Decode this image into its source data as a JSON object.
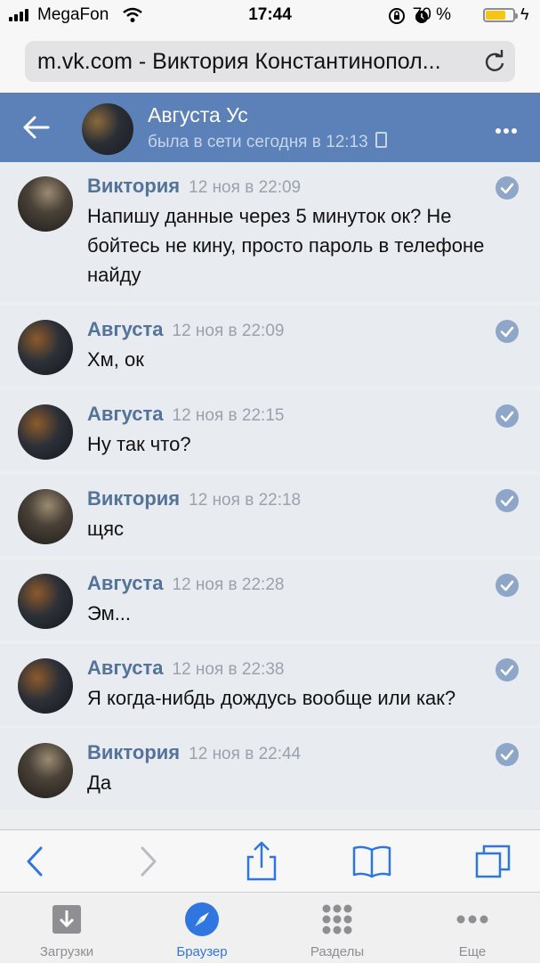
{
  "status_bar": {
    "carrier": "MegaFon",
    "time": "17:44",
    "battery": "70 %",
    "battery_level": 0.7
  },
  "browser": {
    "url": "m.vk.com - Виктория Константинопол..."
  },
  "header": {
    "name": "Августа Ус",
    "status": "была в сети сегодня в 12:13"
  },
  "messages": [
    {
      "author": "Виктория",
      "date": "12 ноя в 22:09",
      "text": "Напишу данные через 5 минуток ок? Не бойтесь не кину, просто пароль в телефоне найду",
      "avatar": "viktoria"
    },
    {
      "author": "Августа",
      "date": "12 ноя в 22:09",
      "text": "Хм, ок",
      "avatar": "avgusta"
    },
    {
      "author": "Августа",
      "date": "12 ноя в 22:15",
      "text": "Ну так что?",
      "avatar": "avgusta"
    },
    {
      "author": "Виктория",
      "date": "12 ноя в 22:18",
      "text": "щяс",
      "avatar": "viktoria"
    },
    {
      "author": "Августа",
      "date": "12 ноя в 22:28",
      "text": "Эм...",
      "avatar": "avgusta"
    },
    {
      "author": "Августа",
      "date": "12 ноя в 22:38",
      "text": "Я когда-нибдь дождусь вообще или как?",
      "avatar": "avgusta"
    },
    {
      "author": "Виктория",
      "date": "12 ноя в 22:44",
      "text": "Да",
      "avatar": "viktoria"
    }
  ],
  "tabs": [
    {
      "label": "Загрузки",
      "icon": "download-icon",
      "active": false
    },
    {
      "label": "Браузер",
      "icon": "compass-icon",
      "active": true
    },
    {
      "label": "Разделы",
      "icon": "grid-icon",
      "active": false
    },
    {
      "label": "Еще",
      "icon": "more-icon",
      "active": false
    }
  ],
  "colors": {
    "header": "#5b81b8",
    "name": "#54739b",
    "accent": "#2f76e0",
    "message_bg": "#e8ebf0"
  }
}
